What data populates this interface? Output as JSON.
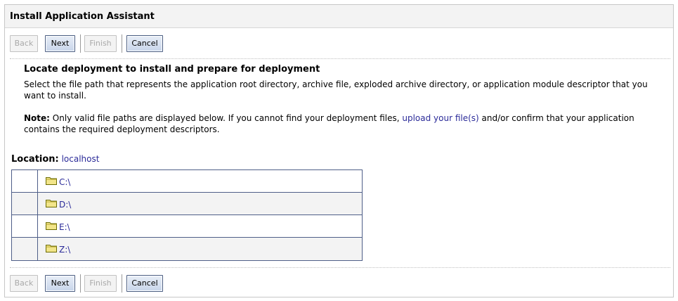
{
  "header": {
    "title": "Install Application Assistant"
  },
  "toolbar": {
    "back_label": "Back",
    "next_label": "Next",
    "finish_label": "Finish",
    "cancel_label": "Cancel"
  },
  "section": {
    "title": "Locate deployment to install and prepare for deployment",
    "description": "Select the file path that represents the application root directory, archive file, exploded archive directory, or application module descriptor that you want to install.",
    "note_label": "Note:",
    "note_before_link": " Only valid file paths are displayed below. If you cannot find your deployment files, ",
    "note_link": "upload your file(s)",
    "note_after_link": " and/or confirm that your application contains the required deployment descriptors."
  },
  "location": {
    "label": "Location:",
    "value": "localhost"
  },
  "directories": [
    {
      "name": "C:\\",
      "icon": "folder-icon"
    },
    {
      "name": "D:\\",
      "icon": "folder-icon"
    },
    {
      "name": "E:\\",
      "icon": "folder-icon"
    },
    {
      "name": "Z:\\",
      "icon": "folder-icon"
    }
  ],
  "colors": {
    "link": "#2b2b99",
    "table_border": "#4e5e88",
    "button_border": "#4a5d82",
    "header_bg": "#f3f3f3"
  }
}
